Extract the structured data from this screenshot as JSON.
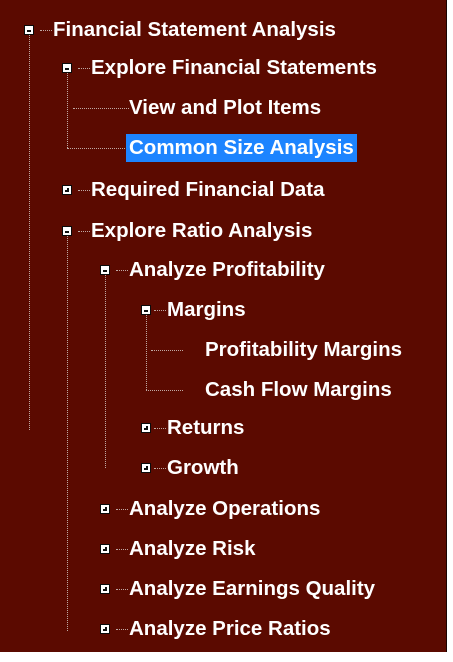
{
  "tree": {
    "root": "Financial Statement Analysis",
    "explore_financial_statements": "Explore Financial Statements",
    "view_plot": "View and Plot Items",
    "common_size": "Common Size Analysis",
    "required_data": "Required Financial Data",
    "explore_ratio": "Explore Ratio Analysis",
    "analyze_profitability": "Analyze Profitability",
    "margins": "Margins",
    "profitability_margins": "Profitability Margins",
    "cash_flow_margins": "Cash Flow Margins",
    "returns": "Returns",
    "growth": "Growth",
    "analyze_operations": "Analyze Operations",
    "analyze_risk": "Analyze Risk",
    "analyze_earnings_quality": "Analyze Earnings Quality",
    "analyze_price_ratios": "Analyze Price Ratios"
  },
  "colors": {
    "background": "#5b0a00",
    "selection": "#1d84ff",
    "text": "#ffffff"
  }
}
